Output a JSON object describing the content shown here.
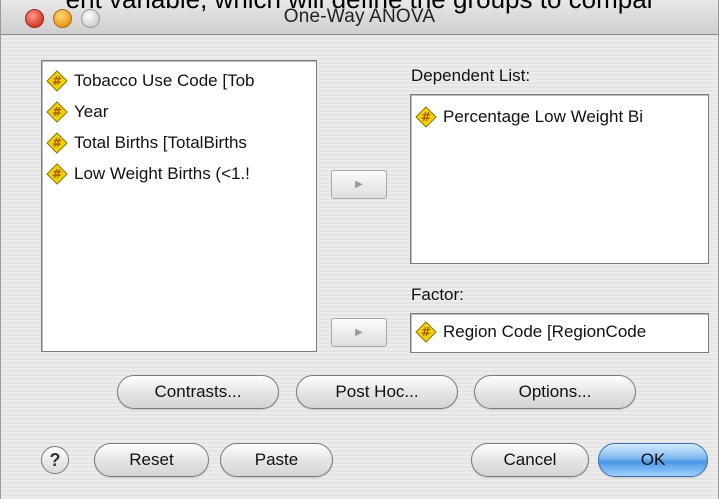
{
  "caption_cut": "ent variable, which will define the groups to compar",
  "window": {
    "title": "One-Way ANOVA"
  },
  "variables": [
    {
      "label": "Tobacco Use Code [Tob",
      "icon": "scale-variable-icon"
    },
    {
      "label": "Year",
      "icon": "scale-variable-icon"
    },
    {
      "label": "Total Births [TotalBirths",
      "icon": "scale-variable-icon"
    },
    {
      "label": "Low Weight Births (<1.!",
      "icon": "scale-variable-icon"
    }
  ],
  "dependent": {
    "label": "Dependent List:",
    "items": [
      {
        "label": "Percentage Low Weight Bi",
        "icon": "scale-variable-icon"
      }
    ]
  },
  "factor": {
    "label": "Factor:",
    "value": "Region Code [RegionCode",
    "icon": "scale-variable-icon"
  },
  "buttons": {
    "contrasts": "Contrasts...",
    "post_hoc": "Post Hoc...",
    "options": "Options...",
    "help": "?",
    "reset": "Reset",
    "paste": "Paste",
    "cancel": "Cancel",
    "ok": "OK"
  },
  "colors": {
    "icon_fill": "#f2d200",
    "default_button": "#4c97e6"
  }
}
